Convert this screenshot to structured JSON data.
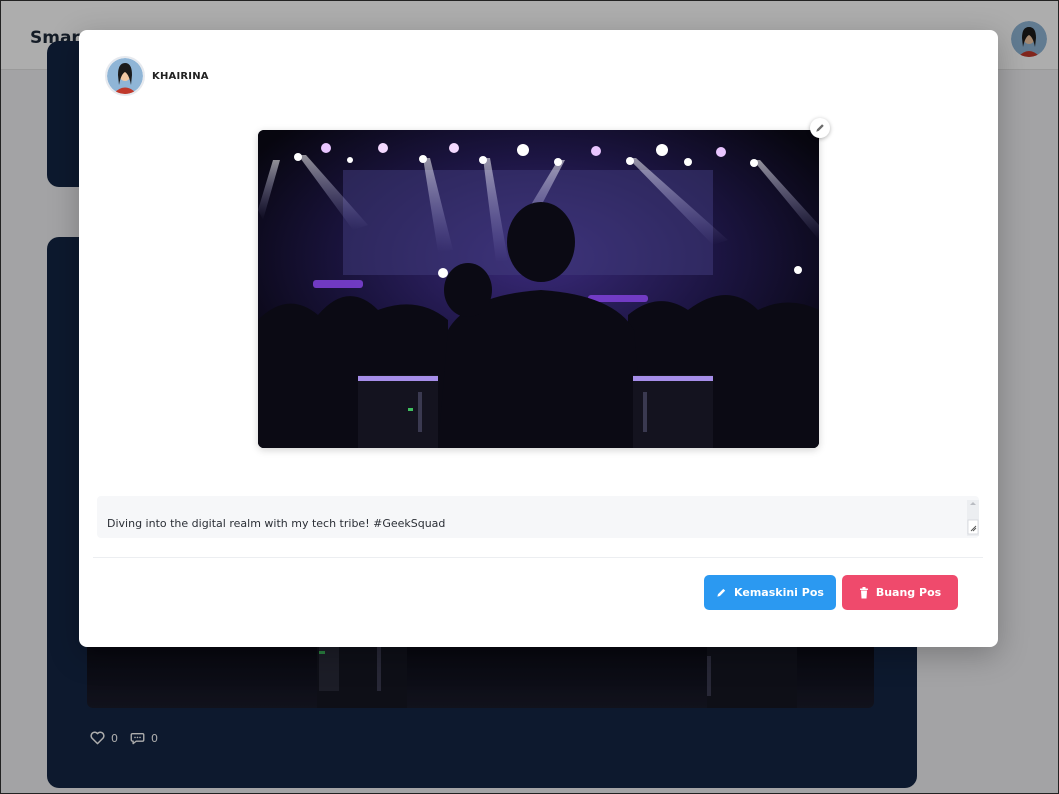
{
  "app": {
    "brand": "Smar"
  },
  "modal": {
    "author": "KHAIRINA",
    "caption": "Diving into the digital realm with my tech tribe! #GeekSquad",
    "update_label": "Kemaskini Pos",
    "delete_label": "Buang Pos"
  },
  "background_post": {
    "likes": "0",
    "comments": "0"
  },
  "icons": {
    "edit_image": "pencil-icon",
    "update": "pencil-icon",
    "delete": "trash-icon",
    "like": "heart-icon",
    "comment": "chat-icon"
  },
  "colors": {
    "navy_card": "#142644",
    "update_button": "#2b99f1",
    "delete_button": "#ef4a6c"
  }
}
